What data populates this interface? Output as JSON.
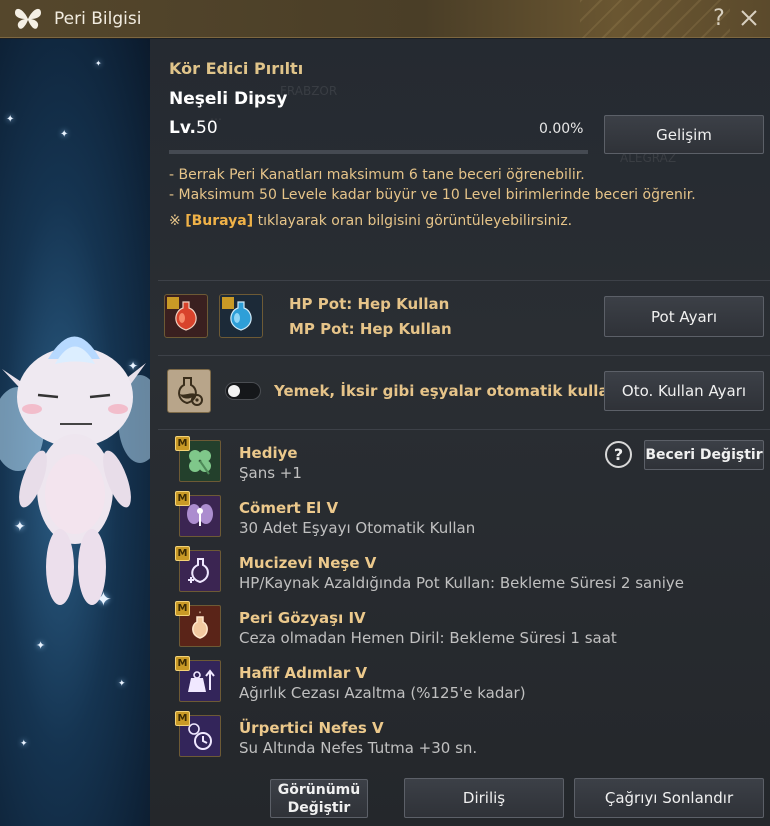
{
  "window": {
    "title": "Peri Bilgisi"
  },
  "pet": {
    "subtitle": "Kör Edici Pırıltı",
    "name": "Neşeli Dipsy",
    "level_prefix": "Lv.",
    "level": "50",
    "exp_percent": "0.00%",
    "exp_fraction": 0.0,
    "growth_button": "Gelişim"
  },
  "notes": {
    "line1": "- Berrak Peri Kanatları maksimum 6 tane beceri öğrenebilir.",
    "line2": "- Maksimum 50 Levele kadar büyür ve 10 Level birimlerinde beceri öğrenir.",
    "mark": "※",
    "link": "[Buraya]",
    "line3_rest": " tıklayarak oran bilgisini görüntüleyebilirsiniz."
  },
  "potions": {
    "hp_label": "HP Pot: Hep Kullan",
    "mp_label": "MP Pot: Hep Kullan",
    "button": "Pot Ayarı"
  },
  "auto_use": {
    "label": "Yemek, İksir gibi eşyalar otomatik kullanılır.",
    "enabled": false,
    "button": "Oto. Kullan Ayarı"
  },
  "skills": {
    "help_icon_text": "?",
    "change_button": "Beceri Değiştir",
    "badge": "M",
    "items": [
      {
        "name": "Hediye",
        "desc": "Şans +1",
        "icon": "clover-icon",
        "color": "#2c5a3a"
      },
      {
        "name": "Cömert El V",
        "desc": "30 Adet Eşyayı Otomatik Kullan",
        "icon": "fairy-icon",
        "color": "#4a2f62"
      },
      {
        "name": "Mucizevi Neşe V",
        "desc": "HP/Kaynak Azaldığında Pot Kullan: Bekleme Süresi 2 saniye",
        "icon": "potion-plus-icon",
        "color": "#4a2f62"
      },
      {
        "name": "Peri Gözyaşı IV",
        "desc": "Ceza olmadan Hemen Diril: Bekleme Süresi 1 saat",
        "icon": "tear-flask-icon",
        "color": "#6a2a1e"
      },
      {
        "name": "Hafif Adımlar V",
        "desc": "Ağırlık Cezası Azaltma (%125'e kadar)",
        "icon": "weight-up-icon",
        "color": "#3e2d63"
      },
      {
        "name": "Ürpertici Nefes V",
        "desc": "Su Altında Nefes Tutma +30 sn.",
        "icon": "breath-timer-icon",
        "color": "#3e2d63"
      }
    ]
  },
  "footer": {
    "appearance_button": "Görünümü Değiştir",
    "revive_button": "Diriliş",
    "end_summon_button": "Çağrıyı Sonlandır"
  },
  "colors": {
    "accent_gold": "#e0c48a",
    "link_orange": "#f0b248",
    "skill_name": "#ecc98c"
  }
}
